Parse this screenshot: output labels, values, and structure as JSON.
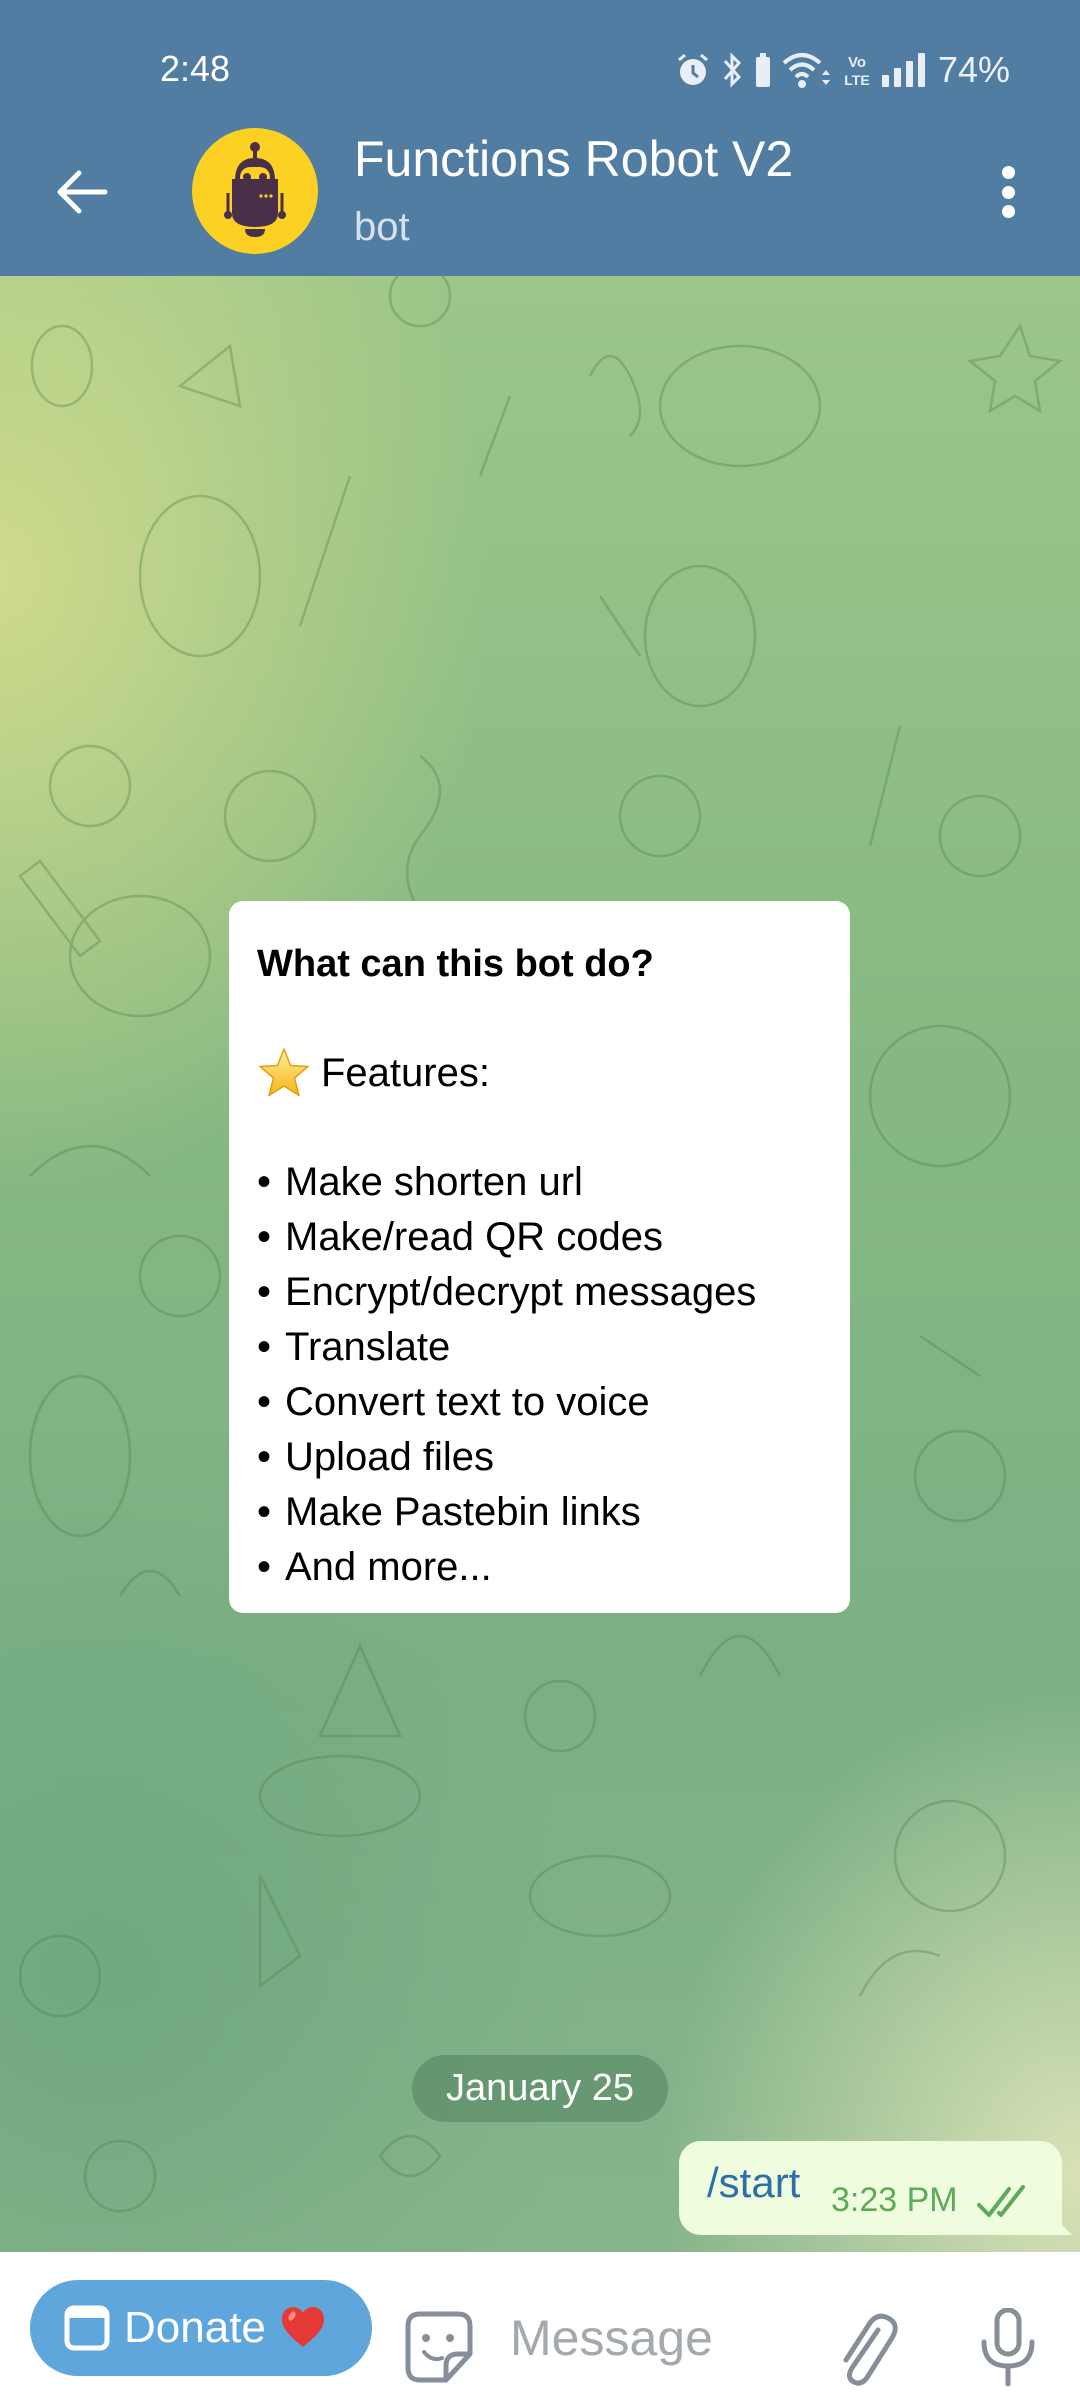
{
  "status_bar": {
    "time": "2:48",
    "icons": [
      "alarm-icon",
      "bluetooth-icon",
      "battery-small-icon",
      "wifi-icon",
      "volte-icon",
      "signal-icon"
    ],
    "volte_top": "Vo",
    "volte_bottom": "LTE",
    "battery": "74%"
  },
  "header": {
    "back_icon": "arrow-left-icon",
    "avatar_icon": "robot-icon",
    "title": "Functions Robot V2",
    "subtitle": "bot",
    "menu_icon": "more-vertical-icon"
  },
  "colors": {
    "header": "#517da2",
    "outgoing_bubble": "#effdde",
    "donate_button": "#5fa6dc",
    "command_link": "#2c6fab",
    "time_check": "#5ea95a",
    "avatar_bg": "#fdd024"
  },
  "info_card": {
    "title": "What can this bot do?",
    "features_emoji": "star-icon",
    "features_label": "Features:",
    "bullet": "•",
    "items": [
      "Make shorten url",
      "Make/read QR codes",
      "Encrypt/decrypt messages",
      "Translate",
      "Convert text to voice",
      "Upload files",
      "Make Pastebin links",
      "And more..."
    ]
  },
  "date_separator": "January 25",
  "messages": [
    {
      "direction": "outgoing",
      "text": "/start",
      "time": "3:23 PM",
      "status": "read"
    }
  ],
  "input_bar": {
    "donate_label": "Donate",
    "donate_emoji": "❤",
    "placeholder": "Message",
    "value": ""
  }
}
